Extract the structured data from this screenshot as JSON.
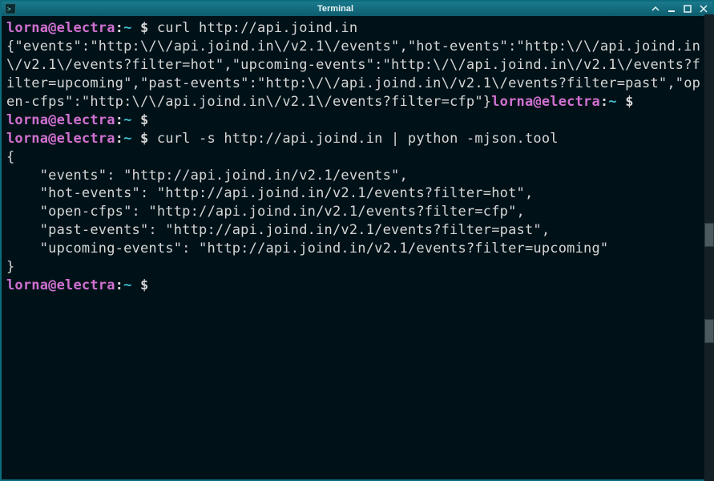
{
  "window": {
    "title": "Terminal",
    "icon": "terminal-icon"
  },
  "colors": {
    "titlebar_bg": "#0d5d6e",
    "terminal_bg": "#001218",
    "prompt_user": "#d070d0",
    "prompt_path": "#3fbfcf",
    "text": "#d6d6d6"
  },
  "prompt": {
    "user_host": "lorna@electra",
    "separator": ":",
    "path": "~",
    "symbol": " $ "
  },
  "lines": {
    "cmd1": "curl http://api.joind.in",
    "out1": "{\"events\":\"http:\\/\\/api.joind.in\\/v2.1\\/events\",\"hot-events\":\"http:\\/\\/api.joind.in\\/v2.1\\/events?filter=hot\",\"upcoming-events\":\"http:\\/\\/api.joind.in\\/v2.1\\/events?filter=upcoming\",\"past-events\":\"http:\\/\\/api.joind.in\\/v2.1\\/events?filter=past\",\"open-cfps\":\"http:\\/\\/api.joind.in\\/v2.1\\/events?filter=cfp\"}",
    "cmd2": "",
    "cmd3": "",
    "cmd4": "curl -s http://api.joind.in | python -mjson.tool",
    "out2_l1": "{",
    "out2_l2": "    \"events\": \"http://api.joind.in/v2.1/events\",",
    "out2_l3": "    \"hot-events\": \"http://api.joind.in/v2.1/events?filter=hot\",",
    "out2_l4": "    \"open-cfps\": \"http://api.joind.in/v2.1/events?filter=cfp\",",
    "out2_l5": "    \"past-events\": \"http://api.joind.in/v2.1/events?filter=past\",",
    "out2_l6": "    \"upcoming-events\": \"http://api.joind.in/v2.1/events?filter=upcoming\"",
    "out2_l7": "}",
    "cmd5": ""
  }
}
